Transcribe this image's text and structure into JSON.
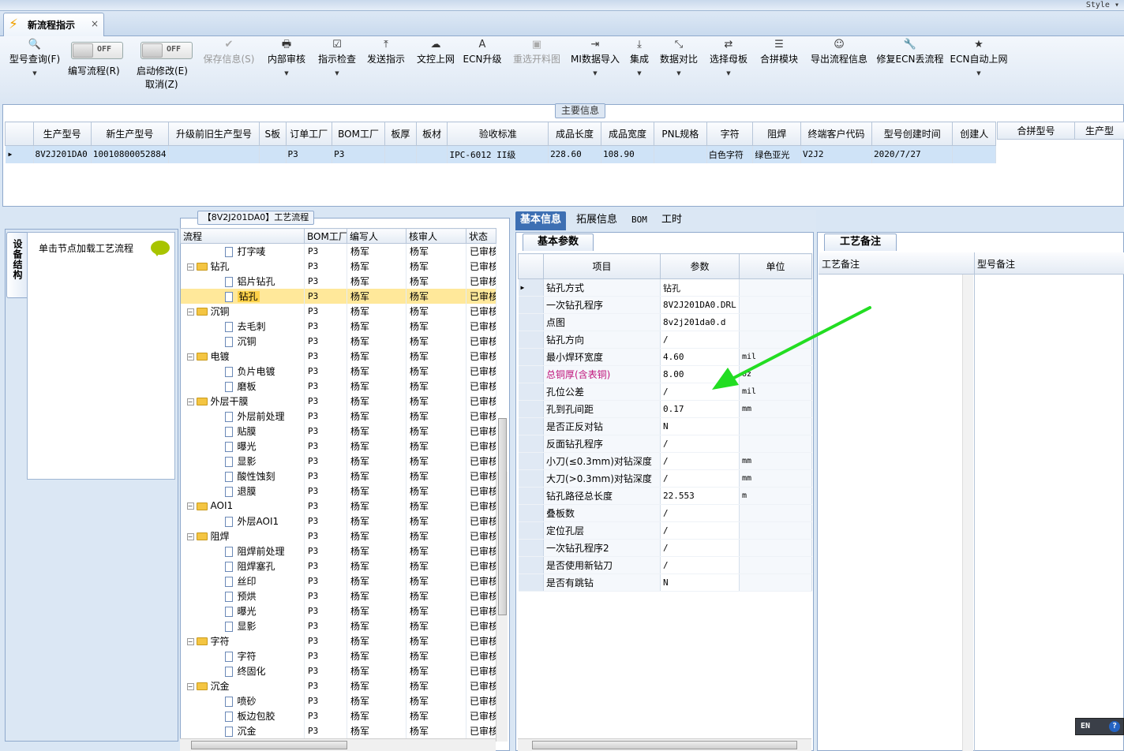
{
  "window": {
    "style_label": "Style ▾"
  },
  "doc_tab": {
    "title": "新流程指示",
    "close": "×"
  },
  "toolbar": [
    {
      "key": "model-query",
      "icon": "🔍",
      "label": "型号查询(F)",
      "dropdown": true,
      "disabled": false
    },
    {
      "key": "save-info",
      "icon": "✔",
      "label": "保存信息(S)",
      "dropdown": false,
      "disabled": true
    },
    {
      "key": "internal-review",
      "icon": "🖶",
      "label": "内部审核",
      "dropdown": true,
      "disabled": false
    },
    {
      "key": "check",
      "icon": "☑",
      "label": "指示检查",
      "dropdown": true,
      "disabled": false
    },
    {
      "key": "send",
      "icon": "⤒",
      "label": "发送指示",
      "dropdown": false,
      "disabled": false
    },
    {
      "key": "upload-doc",
      "icon": "☁",
      "label": "文控上网",
      "dropdown": false,
      "disabled": false
    },
    {
      "key": "ecn-upgrade",
      "icon": "A",
      "label": "ECN升级",
      "dropdown": false,
      "disabled": false
    },
    {
      "key": "reselect-map",
      "icon": "▣",
      "label": "重选开料图",
      "dropdown": false,
      "disabled": true
    },
    {
      "key": "mi-import",
      "icon": "⇥",
      "label": "MI数据导入",
      "dropdown": true,
      "disabled": false
    },
    {
      "key": "integrate",
      "icon": "⤓",
      "label": "集成",
      "dropdown": true,
      "disabled": false
    },
    {
      "key": "compare",
      "icon": "⤡",
      "label": "数据对比",
      "dropdown": true,
      "disabled": false
    },
    {
      "key": "choose-template",
      "icon": "⇄",
      "label": "选择母板",
      "dropdown": true,
      "disabled": false
    },
    {
      "key": "merge-module",
      "icon": "☰",
      "label": "合拼模块",
      "dropdown": false,
      "disabled": false
    },
    {
      "key": "export",
      "icon": "☺",
      "label": "导出流程信息",
      "dropdown": false,
      "disabled": false
    },
    {
      "key": "repair-ecn",
      "icon": "🔧",
      "label": "修复ECN丢流程",
      "dropdown": false,
      "disabled": false
    },
    {
      "key": "ecn-auto",
      "icon": "★",
      "label": "ECN自动上网",
      "dropdown": true,
      "disabled": false
    }
  ],
  "toggles": {
    "write_flow": {
      "state": "OFF",
      "label": "编写流程(R)"
    },
    "start_modify": {
      "state": "OFF",
      "label": "启动修改(E)",
      "label2": "取消(Z)"
    }
  },
  "main_info": {
    "title": "主要信息",
    "columns": [
      "生产型号",
      "新生产型号",
      "升级前旧生产型号",
      "S板",
      "订单工厂",
      "BOM工厂",
      "板厚",
      "板材",
      "验收标准",
      "成品长度",
      "成品宽度",
      "PNL规格",
      "字符",
      "阻焊",
      "终端客户代码",
      "型号创建时间",
      "创建人"
    ],
    "rows": [
      [
        "8V2J201DA0",
        "10010800052884",
        "",
        "",
        "P3",
        "P3",
        "",
        "",
        "IPC-6012 II级",
        "228.60",
        "108.90",
        "",
        "白色字符",
        "绿色亚光",
        "V2J2",
        "2020/7/27",
        ""
      ]
    ],
    "side_columns": [
      "合拼型号",
      "生产型"
    ]
  },
  "nav": {
    "vertical_tab": "设备结构",
    "hint": "单击节点加载工艺流程"
  },
  "process": {
    "title": "【8V2J201DA0】工艺流程",
    "columns": [
      "流程",
      "BOM工厂",
      "编写人",
      "核审人",
      "状态"
    ],
    "rows": [
      {
        "name": "打字唛",
        "level": 1,
        "folder": false,
        "factory": "P3",
        "writer": "杨军",
        "reviewer": "杨军",
        "status": "已审核"
      },
      {
        "name": "钻孔",
        "level": 0,
        "folder": true,
        "factory": "P3",
        "writer": "杨军",
        "reviewer": "杨军",
        "status": "已审核"
      },
      {
        "name": "铝片钻孔",
        "level": 1,
        "folder": false,
        "factory": "P3",
        "writer": "杨军",
        "reviewer": "杨军",
        "status": "已审核"
      },
      {
        "name": "钻孔",
        "level": 1,
        "folder": false,
        "factory": "P3",
        "writer": "杨军",
        "reviewer": "杨军",
        "status": "已审核",
        "selected": true
      },
      {
        "name": "沉铜",
        "level": 0,
        "folder": true,
        "factory": "P3",
        "writer": "杨军",
        "reviewer": "杨军",
        "status": "已审核"
      },
      {
        "name": "去毛刺",
        "level": 1,
        "folder": false,
        "factory": "P3",
        "writer": "杨军",
        "reviewer": "杨军",
        "status": "已审核"
      },
      {
        "name": "沉铜",
        "level": 1,
        "folder": false,
        "factory": "P3",
        "writer": "杨军",
        "reviewer": "杨军",
        "status": "已审核"
      },
      {
        "name": "电镀",
        "level": 0,
        "folder": true,
        "factory": "P3",
        "writer": "杨军",
        "reviewer": "杨军",
        "status": "已审核"
      },
      {
        "name": "负片电镀",
        "level": 1,
        "folder": false,
        "factory": "P3",
        "writer": "杨军",
        "reviewer": "杨军",
        "status": "已审核"
      },
      {
        "name": "磨板",
        "level": 1,
        "folder": false,
        "factory": "P3",
        "writer": "杨军",
        "reviewer": "杨军",
        "status": "已审核"
      },
      {
        "name": "外层干膜",
        "level": 0,
        "folder": true,
        "factory": "P3",
        "writer": "杨军",
        "reviewer": "杨军",
        "status": "已审核"
      },
      {
        "name": "外层前处理",
        "level": 1,
        "folder": false,
        "factory": "P3",
        "writer": "杨军",
        "reviewer": "杨军",
        "status": "已审核"
      },
      {
        "name": "贴膜",
        "level": 1,
        "folder": false,
        "factory": "P3",
        "writer": "杨军",
        "reviewer": "杨军",
        "status": "已审核"
      },
      {
        "name": "曝光",
        "level": 1,
        "folder": false,
        "factory": "P3",
        "writer": "杨军",
        "reviewer": "杨军",
        "status": "已审核"
      },
      {
        "name": "显影",
        "level": 1,
        "folder": false,
        "factory": "P3",
        "writer": "杨军",
        "reviewer": "杨军",
        "status": "已审核"
      },
      {
        "name": "酸性蚀刻",
        "level": 1,
        "folder": false,
        "factory": "P3",
        "writer": "杨军",
        "reviewer": "杨军",
        "status": "已审核"
      },
      {
        "name": "退膜",
        "level": 1,
        "folder": false,
        "factory": "P3",
        "writer": "杨军",
        "reviewer": "杨军",
        "status": "已审核"
      },
      {
        "name": "AOI1",
        "level": 0,
        "folder": true,
        "factory": "P3",
        "writer": "杨军",
        "reviewer": "杨军",
        "status": "已审核"
      },
      {
        "name": "外层AOI1",
        "level": 1,
        "folder": false,
        "factory": "P3",
        "writer": "杨军",
        "reviewer": "杨军",
        "status": "已审核"
      },
      {
        "name": "阻焊",
        "level": 0,
        "folder": true,
        "factory": "P3",
        "writer": "杨军",
        "reviewer": "杨军",
        "status": "已审核"
      },
      {
        "name": "阻焊前处理",
        "level": 1,
        "folder": false,
        "factory": "P3",
        "writer": "杨军",
        "reviewer": "杨军",
        "status": "已审核"
      },
      {
        "name": "阻焊塞孔",
        "level": 1,
        "folder": false,
        "factory": "P3",
        "writer": "杨军",
        "reviewer": "杨军",
        "status": "已审核"
      },
      {
        "name": "丝印",
        "level": 1,
        "folder": false,
        "factory": "P3",
        "writer": "杨军",
        "reviewer": "杨军",
        "status": "已审核"
      },
      {
        "name": "预烘",
        "level": 1,
        "folder": false,
        "factory": "P3",
        "writer": "杨军",
        "reviewer": "杨军",
        "status": "已审核"
      },
      {
        "name": "曝光",
        "level": 1,
        "folder": false,
        "factory": "P3",
        "writer": "杨军",
        "reviewer": "杨军",
        "status": "已审核"
      },
      {
        "name": "显影",
        "level": 1,
        "folder": false,
        "factory": "P3",
        "writer": "杨军",
        "reviewer": "杨军",
        "status": "已审核"
      },
      {
        "name": "字符",
        "level": 0,
        "folder": true,
        "factory": "P3",
        "writer": "杨军",
        "reviewer": "杨军",
        "status": "已审核"
      },
      {
        "name": "字符",
        "level": 1,
        "folder": false,
        "factory": "P3",
        "writer": "杨军",
        "reviewer": "杨军",
        "status": "已审核"
      },
      {
        "name": "终固化",
        "level": 1,
        "folder": false,
        "factory": "P3",
        "writer": "杨军",
        "reviewer": "杨军",
        "status": "已审核"
      },
      {
        "name": "沉金",
        "level": 0,
        "folder": true,
        "factory": "P3",
        "writer": "杨军",
        "reviewer": "杨军",
        "status": "已审核"
      },
      {
        "name": "喷砂",
        "level": 1,
        "folder": false,
        "factory": "P3",
        "writer": "杨军",
        "reviewer": "杨军",
        "status": "已审核"
      },
      {
        "name": "板边包胶",
        "level": 1,
        "folder": false,
        "factory": "P3",
        "writer": "杨军",
        "reviewer": "杨军",
        "status": "已审核"
      },
      {
        "name": "沉金",
        "level": 1,
        "folder": false,
        "factory": "P3",
        "writer": "杨军",
        "reviewer": "杨军",
        "status": "已审核"
      }
    ]
  },
  "detail_tabs": [
    "基本信息",
    "拓展信息",
    "BOM",
    "工时"
  ],
  "basic": {
    "tab": "基本参数",
    "columns": [
      "项目",
      "参数",
      "单位"
    ],
    "rows": [
      {
        "item": "钻孔方式",
        "param": "钻孔",
        "unit": "",
        "current": true
      },
      {
        "item": "一次钻孔程序",
        "param": "8V2J201DA0.DRL",
        "unit": ""
      },
      {
        "item": "点图",
        "param": "8v2j201da0.d",
        "unit": ""
      },
      {
        "item": "钻孔方向",
        "param": "/",
        "unit": ""
      },
      {
        "item": "最小焊环宽度",
        "param": "4.60",
        "unit": "mil"
      },
      {
        "item": "总铜厚(含表铜)",
        "param": "8.00",
        "unit": "oz",
        "highlight": true
      },
      {
        "item": "孔位公差",
        "param": "/",
        "unit": "mil"
      },
      {
        "item": "孔到孔间距",
        "param": "0.17",
        "unit": "mm"
      },
      {
        "item": "是否正反对钻",
        "param": "N",
        "unit": ""
      },
      {
        "item": "反面钻孔程序",
        "param": "/",
        "unit": ""
      },
      {
        "item": "小刀(≤0.3mm)对钻深度",
        "param": "/",
        "unit": "mm"
      },
      {
        "item": "大刀(>0.3mm)对钻深度",
        "param": "/",
        "unit": "mm"
      },
      {
        "item": "钻孔路径总长度",
        "param": "22.553",
        "unit": "m"
      },
      {
        "item": "叠板数",
        "param": "/",
        "unit": ""
      },
      {
        "item": "定位孔层",
        "param": "/",
        "unit": ""
      },
      {
        "item": "一次钻孔程序2",
        "param": "/",
        "unit": ""
      },
      {
        "item": "是否使用新钻刀",
        "param": "/",
        "unit": ""
      },
      {
        "item": "是否有跳钻",
        "param": "N",
        "unit": ""
      }
    ]
  },
  "remarks": {
    "tab": "工艺备注",
    "col1": "工艺备注",
    "col2": "型号备注"
  },
  "status": {
    "lang": "EN",
    "help": "?"
  },
  "colors": {
    "accent": "#3d6fb3",
    "annotation_arrow": "#22dd22",
    "highlight_text": "#c0137a"
  }
}
